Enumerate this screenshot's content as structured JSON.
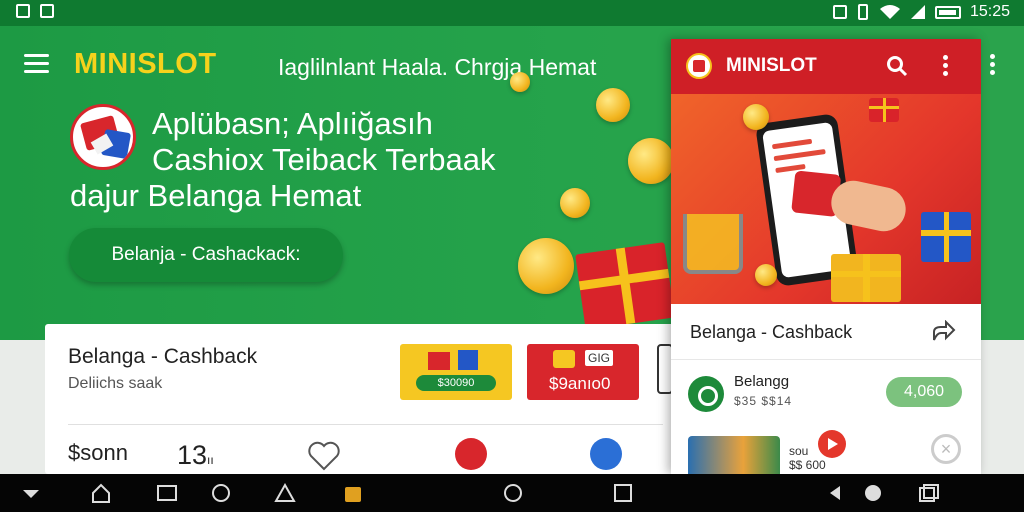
{
  "status_bar": {
    "time": "15:25",
    "left_icons": [
      "app-notification-icon",
      "image-notification-icon"
    ],
    "right_icons": [
      "nfc-icon",
      "vibrate-icon",
      "wifi-icon",
      "signal-icon",
      "battery-icon"
    ]
  },
  "header": {
    "brand": "MINISLOT",
    "tagline": "Iaglilnlant Haala.  Chrgja Hemat"
  },
  "hero": {
    "title_line1": "Aplübasn; Aplıiğasıh",
    "title_line2": "Cashiox Teiback Terbaak",
    "title_line3": "dajur Belanga Hemat",
    "cta_label": "Belanja - Cashackack:"
  },
  "content": {
    "title": "Belanga - Cashback",
    "subtitle": "Deliichs saak",
    "badge1_value": "$30090",
    "badge2_tag": "GIG",
    "badge2_value": "$9anıo0",
    "price": "$sonn",
    "count": "13",
    "count_suffix": "ıı"
  },
  "panel": {
    "brand": "MINISLOT",
    "heading": "Belanga - Cashback",
    "item1": {
      "title": "Belangg",
      "subtitle": "$35 $$14",
      "value": "4,060"
    },
    "item2": {
      "thumb_text": "sou\n$$ 600"
    }
  },
  "colors": {
    "brand_green": "#1d9a44",
    "brand_yellow": "#f6d21c",
    "brand_red": "#cf1f26"
  },
  "nav_icons": [
    "collapse-icon",
    "home-icon",
    "recents-square-icon",
    "gallery-icon",
    "screenshot-icon",
    "store-icon",
    "circle-home-icon",
    "square-icon",
    "back-icon",
    "assistant-icon",
    "overview-icon"
  ]
}
